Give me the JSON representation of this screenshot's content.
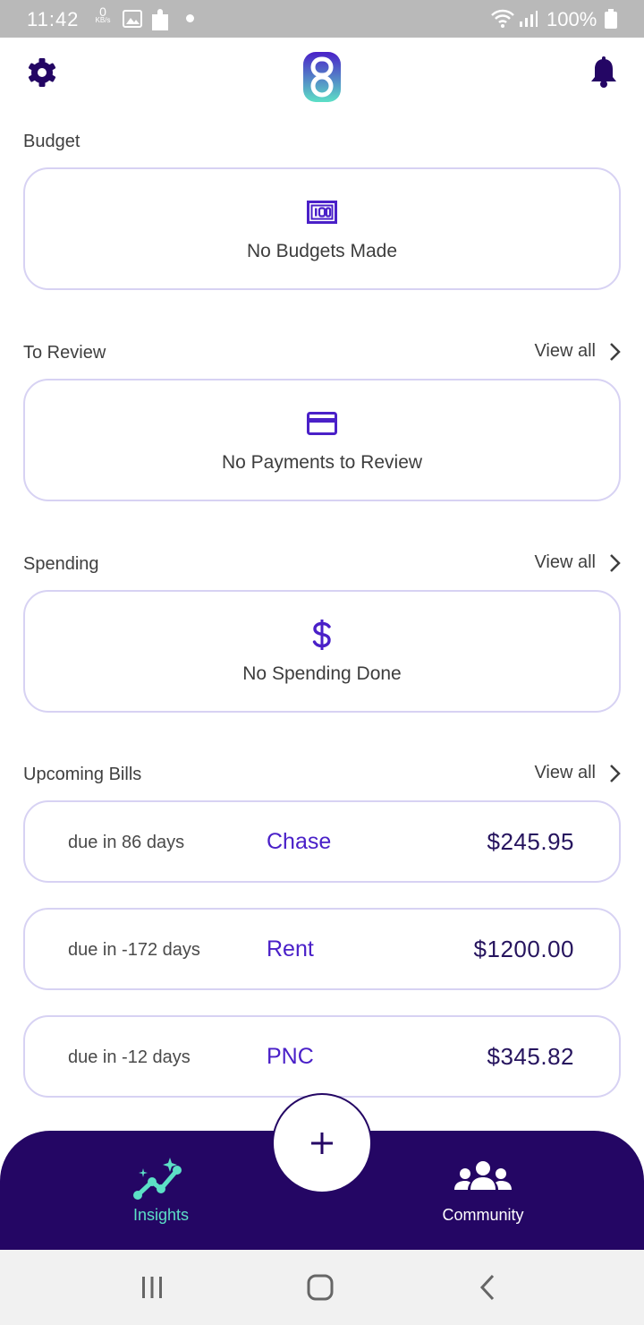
{
  "status_bar": {
    "time": "11:42",
    "net_speed_value": "0",
    "net_speed_unit": "KB/s",
    "battery": "100%"
  },
  "header": {
    "settings_icon": "gear-icon",
    "logo": "app-logo",
    "notifications_icon": "bell-icon"
  },
  "budget": {
    "title": "Budget",
    "empty_label": "No Budgets Made",
    "icon": "budget-icon"
  },
  "to_review": {
    "title": "To Review",
    "view_all": "View all",
    "empty_label": "No Payments to Review",
    "icon": "credit-card-icon"
  },
  "spending": {
    "title": "Spending",
    "view_all": "View all",
    "empty_label": "No Spending Done",
    "icon": "dollar-icon"
  },
  "upcoming_bills": {
    "title": "Upcoming Bills",
    "view_all": "View all",
    "items": [
      {
        "due": "due in 86 days",
        "payee": "Chase",
        "amount": "$245.95"
      },
      {
        "due": "due in -172 days",
        "payee": "Rent",
        "amount": "$1200.00"
      },
      {
        "due": "due in -12 days",
        "payee": "PNC",
        "amount": "$345.82"
      }
    ]
  },
  "bottom_nav": {
    "insights_label": "Insights",
    "community_label": "Community",
    "add_icon": "plus-icon"
  },
  "colors": {
    "accent": "#4a20c8",
    "nav_background": "#240664",
    "active_tab": "#5ce0c6",
    "card_border": "#d7d2f3"
  }
}
